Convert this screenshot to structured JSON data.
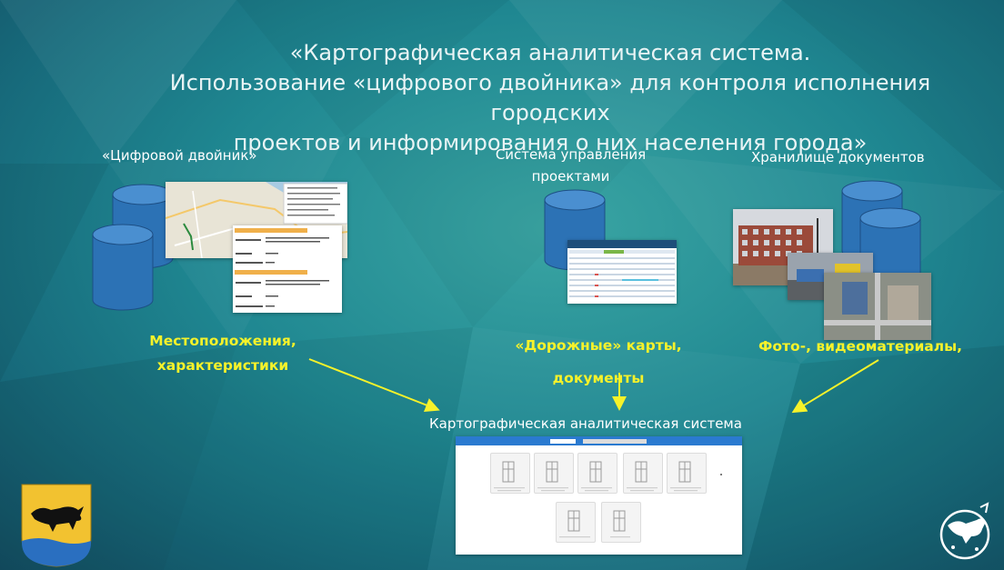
{
  "slide": {
    "title_lines": [
      "«Картографическая аналитическая система.",
      "Использование «цифрового двойника» для контроля исполнения городских",
      "проектов и информирования о них населения города»"
    ]
  },
  "sections": {
    "digital_twin": {
      "heading": "«Цифровой двойник»",
      "caption_lines": [
        "Местоположения,",
        "характеристики"
      ]
    },
    "project_management": {
      "heading_lines": [
        "Система управления",
        "проектами"
      ],
      "caption_lines": [
        "«Дорожные» карты,",
        "документы"
      ]
    },
    "document_storage": {
      "heading": "Хранилище документов",
      "caption": "Фото-, видеоматериалы,"
    }
  },
  "target": {
    "label": "Картографическая аналитическая система"
  },
  "colors": {
    "cylinder": "#2c72b5",
    "cylinder_top": "#4a8fd0",
    "caption": "#f6f22a",
    "background": "#1f8791"
  },
  "icons": [
    "city-coat-of-arms-icon",
    "fox-emblem-icon"
  ]
}
